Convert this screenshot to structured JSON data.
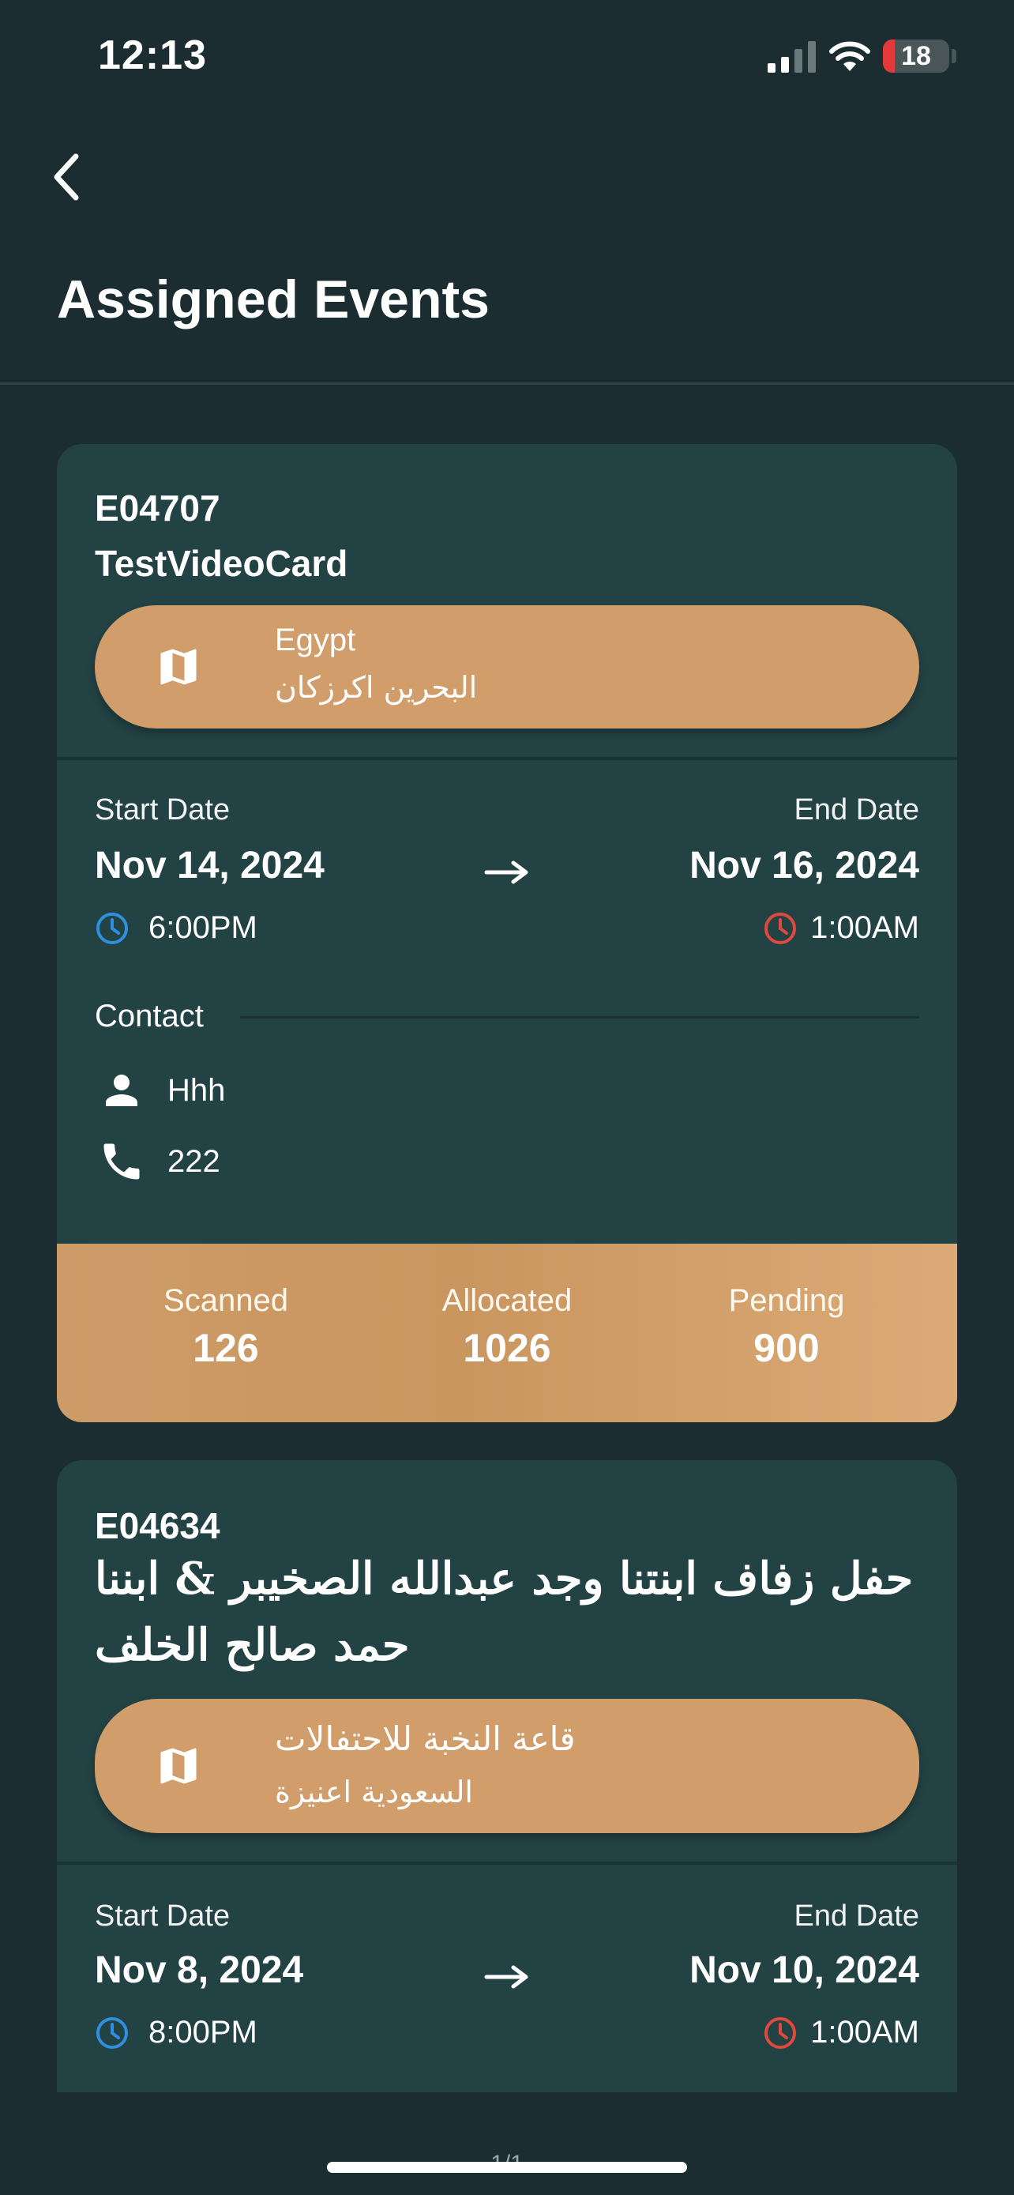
{
  "status_bar": {
    "time": "12:13",
    "battery": "18",
    "battery_level": 0.18
  },
  "header": {
    "title": "Assigned Events"
  },
  "labels": {
    "start_date": "Start Date",
    "end_date": "End Date",
    "contact": "Contact",
    "scanned": "Scanned",
    "allocated": "Allocated",
    "pending": "Pending"
  },
  "events": [
    {
      "code": "E04707",
      "name": "TestVideoCard",
      "venue_line1": "Egypt",
      "venue_line2": "البحرين اكرزكان",
      "start_date": "Nov 14, 2024",
      "end_date": "Nov 16, 2024",
      "start_time": "6:00PM",
      "end_time": "1:00AM",
      "contact_name": "Hhh",
      "contact_phone": "222",
      "scanned": "126",
      "allocated": "1026",
      "pending": "900"
    },
    {
      "code": "E04634",
      "name": "حفل زفاف ابنتنا وجد عبدالله الصخيبر & ابننا حمد صالح الخلف",
      "venue_line1": "قاعة النخبة للاحتفالات",
      "venue_line2": "السعودية اعنيزة",
      "start_date": "Nov 8, 2024",
      "end_date": "Nov 10, 2024",
      "start_time": "8:00PM",
      "end_time": "1:00AM"
    }
  ],
  "pager": "1/1",
  "colors": {
    "background": "#1c2d31",
    "card": "#234244",
    "accent": "#d09d6b",
    "start_clock": "#2f8fe0",
    "end_clock": "#e04a3e"
  },
  "icons": [
    "back-chevron-icon",
    "map-icon",
    "arrow-right-icon",
    "clock-icon",
    "person-icon",
    "phone-icon"
  ]
}
